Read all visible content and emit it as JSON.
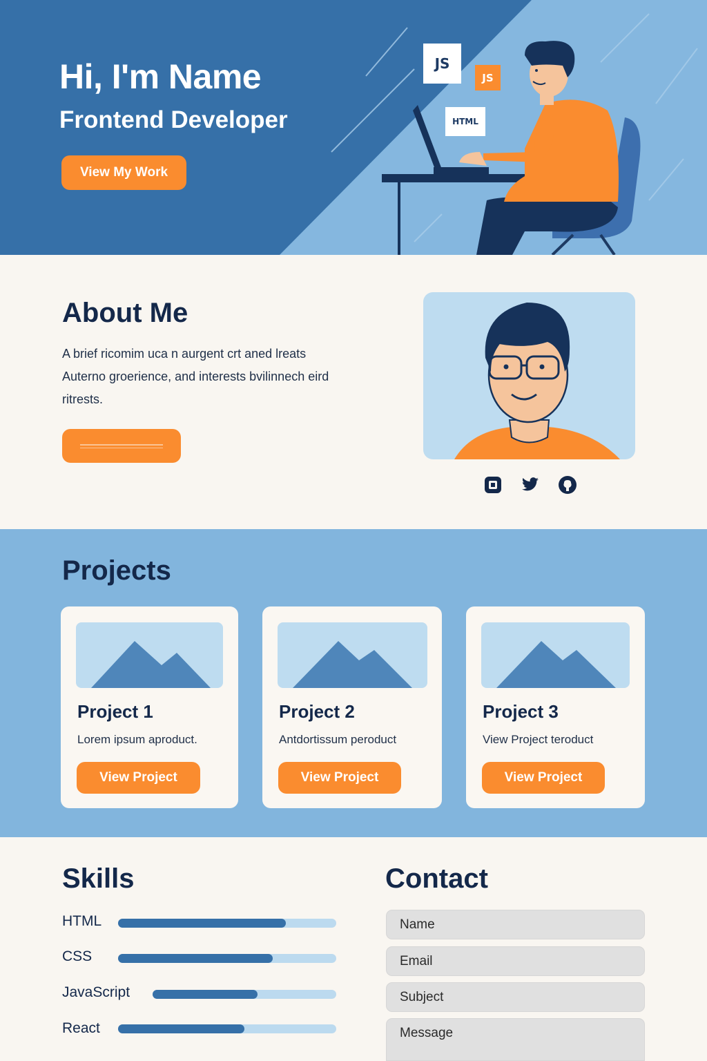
{
  "hero": {
    "title": "Hi, I'm Name",
    "subtitle": "Frontend Developer",
    "cta_label": "View My Work",
    "badges": [
      "JS",
      "JS",
      "HTML"
    ]
  },
  "about": {
    "title": "About Me",
    "text": "A brief ricomim uca n aurgent crt aned lreats Auterno groerience, and interests bvilinnech eird ritrests.",
    "socials": [
      "instagram-icon",
      "twitter-icon",
      "github-icon"
    ]
  },
  "projects": {
    "title": "Projects",
    "items": [
      {
        "title": "Project 1",
        "description": "Lorem ipsum aproduct.",
        "button": "View Project"
      },
      {
        "title": "Project 2",
        "description": "Antdortissum peroduct",
        "button": "View Project"
      },
      {
        "title": "Project 3",
        "description": "View Project teroduct",
        "button": "View Project"
      }
    ]
  },
  "skills": {
    "title": "Skills",
    "items": [
      {
        "name": "HTML",
        "level": 0.77
      },
      {
        "name": "CSS",
        "level": 0.71
      },
      {
        "name": "JavaScript",
        "level": 0.57
      },
      {
        "name": "React",
        "level": 0.58
      }
    ]
  },
  "contact": {
    "title": "Contact",
    "fields": {
      "name": "Name",
      "email": "Email",
      "subject": "Subject",
      "message": "Message"
    }
  },
  "colors": {
    "hero_dark": "#3670a8",
    "hero_light": "#85b7df",
    "accent": "#fa8c2f",
    "navy": "#14284a",
    "projects_bg": "#82b5dd"
  }
}
